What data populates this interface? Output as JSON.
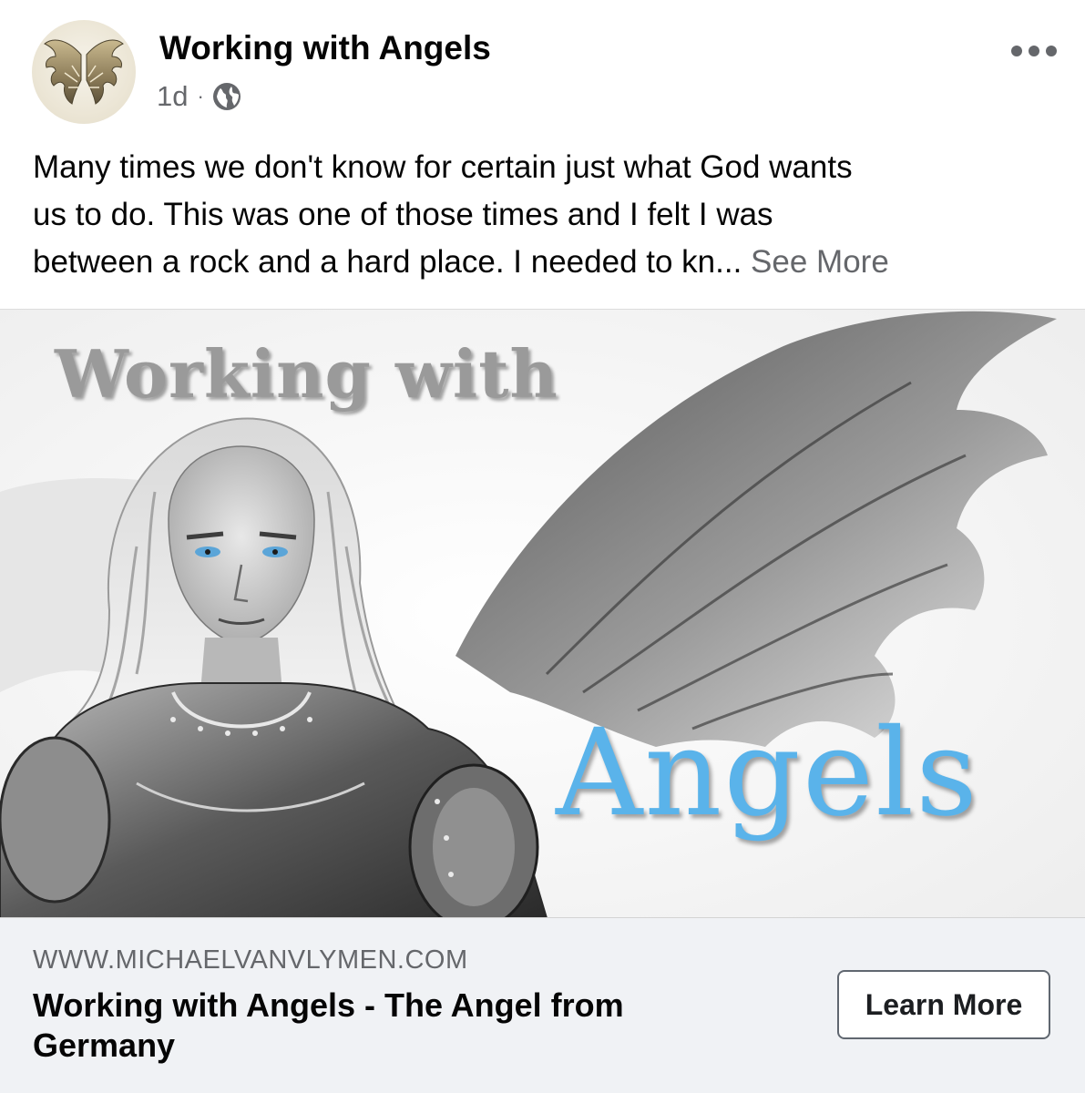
{
  "header": {
    "page_name": "Working with Angels",
    "time": "1d",
    "separator": "·",
    "privacy_icon": "globe-icon",
    "more_icon": "more-options-icon",
    "avatar_icon": "angel-wings-avatar"
  },
  "post": {
    "text_lines": [
      "Many times we don't know for certain just what God wants",
      "us to do. This was one of those times and I felt I was",
      "between a rock and a hard place. I needed to kn..."
    ],
    "see_more": "See More"
  },
  "link_image": {
    "title_top": "Working with",
    "title_bottom": "Angels"
  },
  "link_preview": {
    "domain": "WWW.MICHAELVANVLYMEN.COM",
    "headline": "Working with Angels - The Angel from Germany",
    "cta": "Learn More"
  },
  "colors": {
    "text_primary": "#050505",
    "text_secondary": "#65676b",
    "footer_bg": "#f0f2f5",
    "angels_blue": "#5ab3ea"
  }
}
